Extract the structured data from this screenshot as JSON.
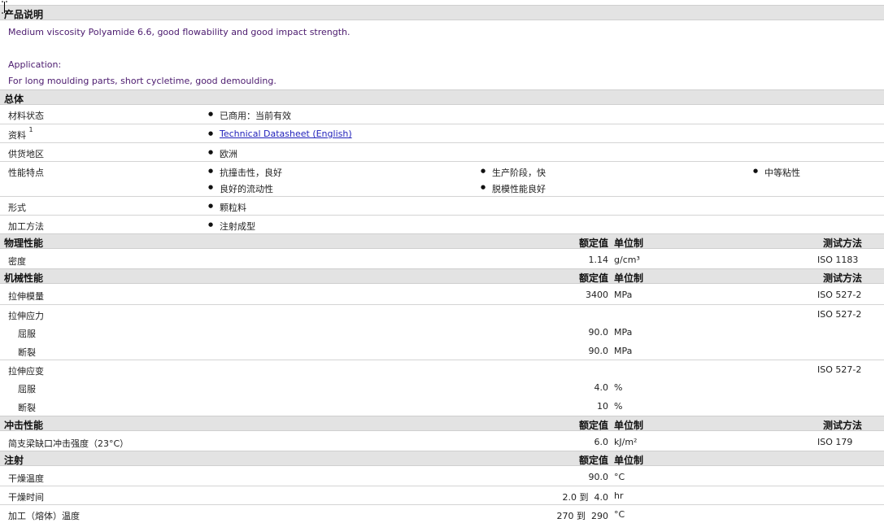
{
  "header_cols": {
    "nominal": "额定值",
    "unit": "单位制",
    "test": "测试方法"
  },
  "product": {
    "title": "产品说明",
    "line1": "Medium viscosity Polyamide 6.6, good flowability and good impact strength.",
    "line2": "Application:",
    "line3": "For long moulding parts, short cycletime, good demoulding."
  },
  "general": {
    "title": "总体",
    "status_label": "材料状态",
    "status_value": "已商用：当前有效",
    "docs_label": "资料",
    "docs_sup": "1",
    "docs_link": "Technical Datasheet (English)",
    "region_label": "供货地区",
    "region_value": "欧洲",
    "features_label": "性能特点",
    "features": [
      "抗撞击性，良好",
      "生产阶段，快",
      "中等粘性",
      "良好的流动性",
      "脱模性能良好"
    ],
    "form_label": "形式",
    "form_value": "颗粒料",
    "process_label": "加工方法",
    "process_value": "注射成型"
  },
  "physical": {
    "title": "物理性能",
    "density_label": "密度",
    "density_value": "1.14",
    "density_unit": "g/cm³",
    "density_test": "ISO 1183"
  },
  "mechanical": {
    "title": "机械性能",
    "modulus_label": "拉伸模量",
    "modulus_value": "3400",
    "modulus_unit": "MPa",
    "modulus_test": "ISO 527-2",
    "stress_label": "拉伸应力",
    "stress_test": "ISO 527-2",
    "stress_yield_label": "屈服",
    "stress_yield_value": "90.0",
    "stress_yield_unit": "MPa",
    "stress_break_label": "断裂",
    "stress_break_value": "90.0",
    "stress_break_unit": "MPa",
    "strain_label": "拉伸应变",
    "strain_test": "ISO 527-2",
    "strain_yield_label": "屈服",
    "strain_yield_value": "4.0",
    "strain_yield_unit": "%",
    "strain_break_label": "断裂",
    "strain_break_value": "10",
    "strain_break_unit": "%"
  },
  "impact": {
    "title": "冲击性能",
    "charpy_label": "简支梁缺口冲击强度（23°C）",
    "charpy_value": "6.0",
    "charpy_unit": "kJ/m²",
    "charpy_test": "ISO 179"
  },
  "injection": {
    "title": "注射",
    "dry_temp_label": "干燥温度",
    "dry_temp_value": "90.0",
    "dry_temp_unit": "°C",
    "dry_time_label": "干燥时间",
    "dry_time_value": "2.0 到  4.0",
    "dry_time_unit": "hr",
    "melt_label": "加工（熔体）温度",
    "melt_value": "270 到  290",
    "melt_unit": "°C"
  },
  "colors": {
    "section_bg": "#e3e3e3",
    "desc_text": "#4b1a6e",
    "link": "#2222bb"
  }
}
